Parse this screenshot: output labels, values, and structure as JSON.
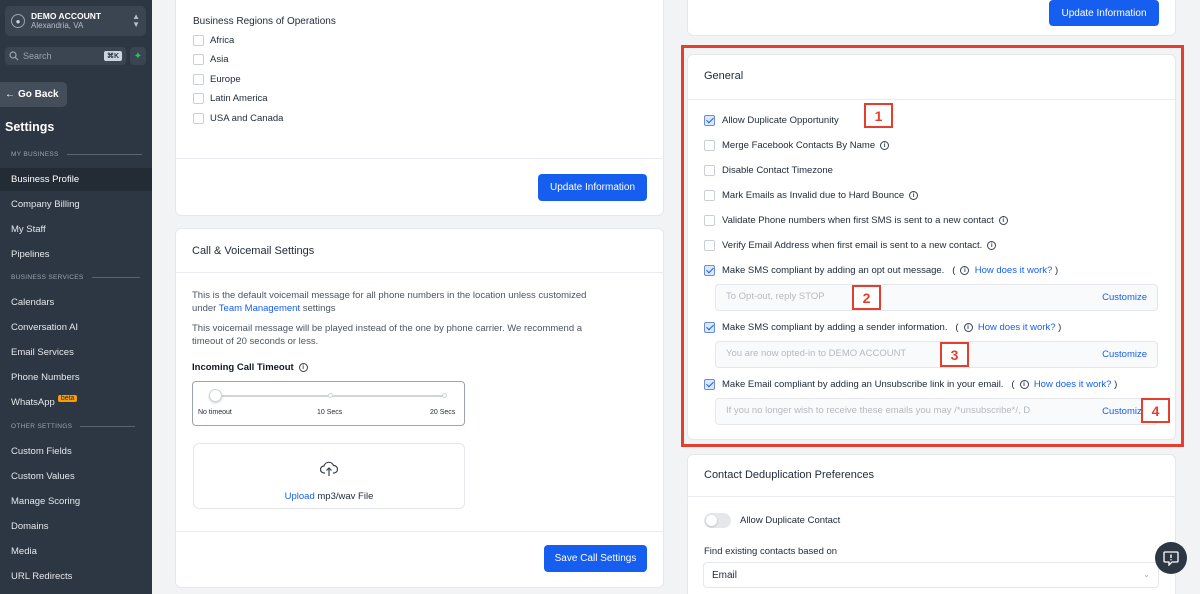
{
  "account": {
    "name": "DEMO ACCOUNT",
    "location": "Alexandria, VA"
  },
  "search": {
    "placeholder": "Search",
    "shortcut": "⌘K"
  },
  "sidebar": {
    "go_back": "Go Back",
    "title": "Settings",
    "sections": {
      "my_business": "MY BUSINESS",
      "business_services": "BUSINESS SERVICES",
      "other_settings": "OTHER SETTINGS"
    },
    "items": {
      "business_profile": "Business Profile",
      "company_billing": "Company Billing",
      "my_staff": "My Staff",
      "pipelines": "Pipelines",
      "calendars": "Calendars",
      "conversation_ai": "Conversation AI",
      "email_services": "Email Services",
      "phone_numbers": "Phone Numbers",
      "whatsapp": "WhatsApp",
      "whatsapp_badge": "beta",
      "custom_fields": "Custom Fields",
      "custom_values": "Custom Values",
      "manage_scoring": "Manage Scoring",
      "domains": "Domains",
      "media": "Media",
      "url_redirects": "URL Redirects"
    }
  },
  "regions": {
    "title": "Business Regions of Operations",
    "options": [
      "Africa",
      "Asia",
      "Europe",
      "Latin America",
      "USA and Canada"
    ],
    "update_button": "Update Information"
  },
  "right_top": {
    "update_button": "Update Information"
  },
  "call_settings": {
    "title": "Call & Voicemail Settings",
    "desc1_pre": "This is the default voicemail message for all phone numbers in the location unless customized",
    "desc1_under": "under",
    "desc1_link": "Team Management",
    "desc1_post": "settings",
    "desc2_line1": "This voicemail message will be played instead of the one by phone carrier. We recommend a",
    "desc2_line2": "timeout of 20 seconds or less.",
    "timeout_label": "Incoming Call Timeout",
    "slider": {
      "labels": [
        "No timeout",
        "10 Secs",
        "20 Secs"
      ],
      "value_fraction": 0
    },
    "upload_link": "Upload",
    "upload_suffix": "mp3/wav File",
    "save_button": "Save Call Settings"
  },
  "general": {
    "title": "General",
    "options": [
      {
        "label": "Allow Duplicate Opportunity",
        "checked": true,
        "info": false
      },
      {
        "label": "Merge Facebook Contacts By Name",
        "checked": false,
        "info": true
      },
      {
        "label": "Disable Contact Timezone",
        "checked": false,
        "info": false
      },
      {
        "label": "Mark Emails as Invalid due to Hard Bounce",
        "checked": false,
        "info": true
      },
      {
        "label": "Validate Phone numbers when first SMS is sent to a new contact",
        "checked": false,
        "info": true
      },
      {
        "label": "Verify Email Address when first email is sent to a new contact.",
        "checked": false,
        "info": true
      }
    ],
    "sms_optout": {
      "label": "Make SMS compliant by adding an opt out message.",
      "how": "How does it work?",
      "placeholder": "To Opt-out, reply STOP",
      "customize": "Customize"
    },
    "sms_sender": {
      "label": "Make SMS compliant by adding a sender information.",
      "how": "How does it work?",
      "placeholder": "You are now opted-in to DEMO ACCOUNT",
      "customize": "Customize"
    },
    "email_unsub": {
      "label": "Make Email compliant by adding an Unsubscribe link in your email.",
      "how": "How does it work?",
      "placeholder": "If you no longer wish to receive these emails you may /*unsubscribe*/, D",
      "customize": "Customize"
    },
    "paren_open": "(",
    "paren_close": ")"
  },
  "annotations": {
    "badges": [
      "1",
      "2",
      "3",
      "4"
    ],
    "color": "#e53e2f"
  },
  "dedup": {
    "title": "Contact Deduplication Preferences",
    "toggle_label": "Allow Duplicate Contact",
    "toggle_on": false,
    "find_label": "Find existing contacts based on",
    "select_value": "Email"
  },
  "colors": {
    "accent": "#155eef",
    "sidebar": "#2d3743",
    "annotation": "#e53e2f"
  }
}
